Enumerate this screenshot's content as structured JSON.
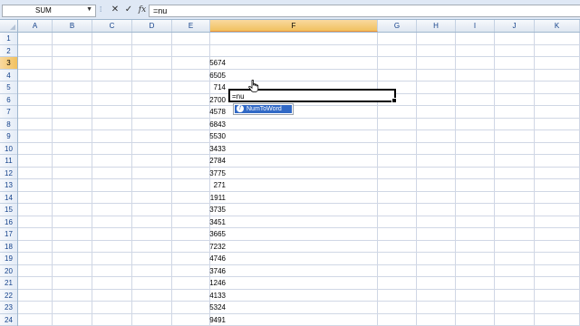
{
  "formula_bar": {
    "name_box": "SUM",
    "name_box_arrow": "▼",
    "grip": "⁞",
    "cancel_symbol": "✕",
    "enter_symbol": "✓",
    "fx_symbol": "fx",
    "formula": "=nu"
  },
  "columns": [
    "A",
    "B",
    "C",
    "D",
    "E",
    "F",
    "G",
    "H",
    "I",
    "J",
    "K"
  ],
  "rows": [
    "1",
    "2",
    "3",
    "4",
    "5",
    "6",
    "7",
    "8",
    "9",
    "10",
    "11",
    "12",
    "13",
    "14",
    "15",
    "16",
    "17",
    "18",
    "19",
    "20",
    "21",
    "22",
    "23",
    "24"
  ],
  "active": {
    "column": "F",
    "row": "3",
    "text": "=nu"
  },
  "column_e_values": [
    {
      "row": "3",
      "value": "5674"
    },
    {
      "row": "4",
      "value": "6505"
    },
    {
      "row": "5",
      "value": "714"
    },
    {
      "row": "6",
      "value": "2700"
    },
    {
      "row": "7",
      "value": "4578"
    },
    {
      "row": "8",
      "value": "6843"
    },
    {
      "row": "9",
      "value": "5530"
    },
    {
      "row": "10",
      "value": "3433"
    },
    {
      "row": "11",
      "value": "2784"
    },
    {
      "row": "12",
      "value": "3775"
    },
    {
      "row": "13",
      "value": "271"
    },
    {
      "row": "14",
      "value": "1911"
    },
    {
      "row": "15",
      "value": "3735"
    },
    {
      "row": "16",
      "value": "3451"
    },
    {
      "row": "17",
      "value": "3665"
    },
    {
      "row": "18",
      "value": "7232"
    },
    {
      "row": "19",
      "value": "4746"
    },
    {
      "row": "20",
      "value": "3746"
    },
    {
      "row": "21",
      "value": "1246"
    },
    {
      "row": "22",
      "value": "4133"
    },
    {
      "row": "23",
      "value": "5324"
    },
    {
      "row": "24",
      "value": "9491"
    }
  ],
  "autocomplete": {
    "icon": "function-icon",
    "icon_glyph": "f",
    "item": "NumToWord"
  },
  "colors": {
    "header_bg": "#dfe7f1",
    "active_header": "#f1c15f",
    "selection": "#3169c6",
    "grid_line": "#d0d7e5"
  }
}
